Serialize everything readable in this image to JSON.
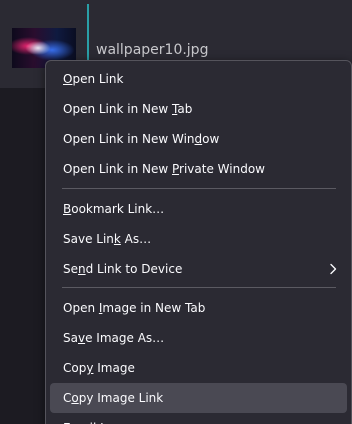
{
  "file": {
    "name": "wallpaper10.jpg"
  },
  "context_menu": {
    "items": [
      {
        "id": "open-link",
        "label": "Open Link",
        "access_key": "O"
      },
      {
        "id": "open-link-new-tab",
        "label": "Open Link in New Tab",
        "access_key": "T"
      },
      {
        "id": "open-link-new-window",
        "label": "Open Link in New Window",
        "access_key": "d"
      },
      {
        "id": "open-link-new-private-window",
        "label": "Open Link in New Private Window",
        "access_key": "P"
      },
      {
        "id": "bookmark-link",
        "label": "Bookmark Link…",
        "access_key": "B"
      },
      {
        "id": "save-link-as",
        "label": "Save Link As…",
        "access_key": "k"
      },
      {
        "id": "send-link-to-device",
        "label": "Send Link to Device",
        "access_key": "n",
        "submenu": true
      },
      {
        "id": "open-image-new-tab",
        "label": "Open Image in New Tab",
        "access_key": "I"
      },
      {
        "id": "save-image-as",
        "label": "Save Image As…",
        "access_key": "v"
      },
      {
        "id": "copy-image",
        "label": "Copy Image",
        "access_key": "y"
      },
      {
        "id": "copy-image-link",
        "label": "Copy Image Link",
        "access_key": "o",
        "hovered": true
      },
      {
        "id": "email-image",
        "label": "Email Image…",
        "access_key": "g"
      }
    ]
  },
  "icons": {
    "submenu": "chevron-right-icon"
  }
}
